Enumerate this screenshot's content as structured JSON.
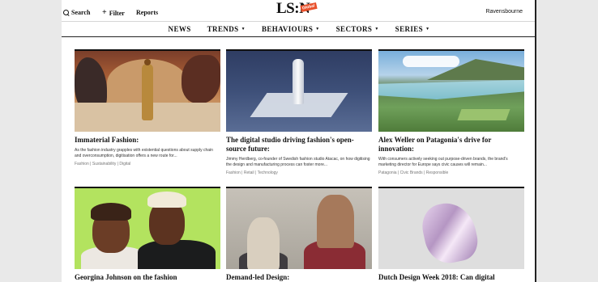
{
  "topbar": {
    "search_label": "Search",
    "filter_label": "Filter",
    "reports_label": "Reports",
    "account_label": "Ravensbourne"
  },
  "logo": {
    "text": "LS:N",
    "badge": "Global"
  },
  "nav": {
    "items": [
      {
        "label": "NEWS",
        "has_caret": false
      },
      {
        "label": "TRENDS",
        "has_caret": true
      },
      {
        "label": "BEHAVIOURS",
        "has_caret": true
      },
      {
        "label": "SECTORS",
        "has_caret": true
      },
      {
        "label": "SERIES",
        "has_caret": true
      }
    ],
    "caret_glyph": "▼"
  },
  "cards": [
    {
      "title": "Immaterial Fashion:",
      "description": "As the fashion industry grapples with existential questions about supply chain and overconsumption, digitisation offers a new route for...",
      "tags": "Fashion | Sustainability | Digital"
    },
    {
      "title": "The digital studio driving fashion's open-source future:",
      "description": "Jimmy Herdberg, co-founder of Swedish fashion studio Atacac, on how digitising the design and manufacturing process can foster more...",
      "tags": "Fashion | Retail | Technology"
    },
    {
      "title": "Alex Weller on Patagonia's drive for innovation:",
      "description": "With consumers actively seeking out purpose-driven brands, the brand's marketing director for Europe says civic causes will remain...",
      "tags": "Patagonia | Civic Brands | Responsible"
    },
    {
      "title": "Georgina Johnson on the fashion",
      "description": "",
      "tags": ""
    },
    {
      "title": "Demand-led Design:",
      "description": "",
      "tags": ""
    },
    {
      "title": "Dutch Design Week 2018: Can digital",
      "description": "",
      "tags": ""
    }
  ]
}
